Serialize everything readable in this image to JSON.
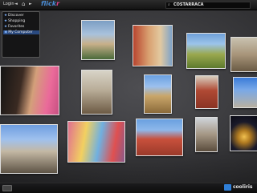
{
  "topbar": {
    "login_label": "Login",
    "back_glyph": "◄",
    "forward_glyph": "►",
    "home_glyph": "⌂",
    "source_part1": "flick",
    "source_part2": "r",
    "search_icon": "⌕",
    "search_value": "COSTARRACA"
  },
  "menu": {
    "items": [
      {
        "icon": "★",
        "label": "Discover"
      },
      {
        "icon": "★",
        "label": "Shopping"
      },
      {
        "icon": "★",
        "label": "Favorites"
      },
      {
        "icon": "▣",
        "label": "My Computer"
      }
    ]
  },
  "photos": [
    {
      "desc": "church-tower"
    },
    {
      "desc": "street-buildings"
    },
    {
      "desc": "garden-terrace"
    },
    {
      "desc": "stone-houses"
    },
    {
      "desc": "girl-portrait"
    },
    {
      "desc": "church-interior"
    },
    {
      "desc": "church-facade"
    },
    {
      "desc": "red-facade"
    },
    {
      "desc": "blue-building"
    },
    {
      "desc": "cathedral"
    },
    {
      "desc": "market-stall"
    },
    {
      "desc": "red-building"
    },
    {
      "desc": "old-church"
    },
    {
      "desc": "night-building"
    }
  ],
  "bottombar": {
    "brand": "cooliris"
  },
  "colors": {
    "accent": "#2f7fd8",
    "flickr_blue": "#4a8cd4",
    "flickr_pink": "#e0408a"
  }
}
